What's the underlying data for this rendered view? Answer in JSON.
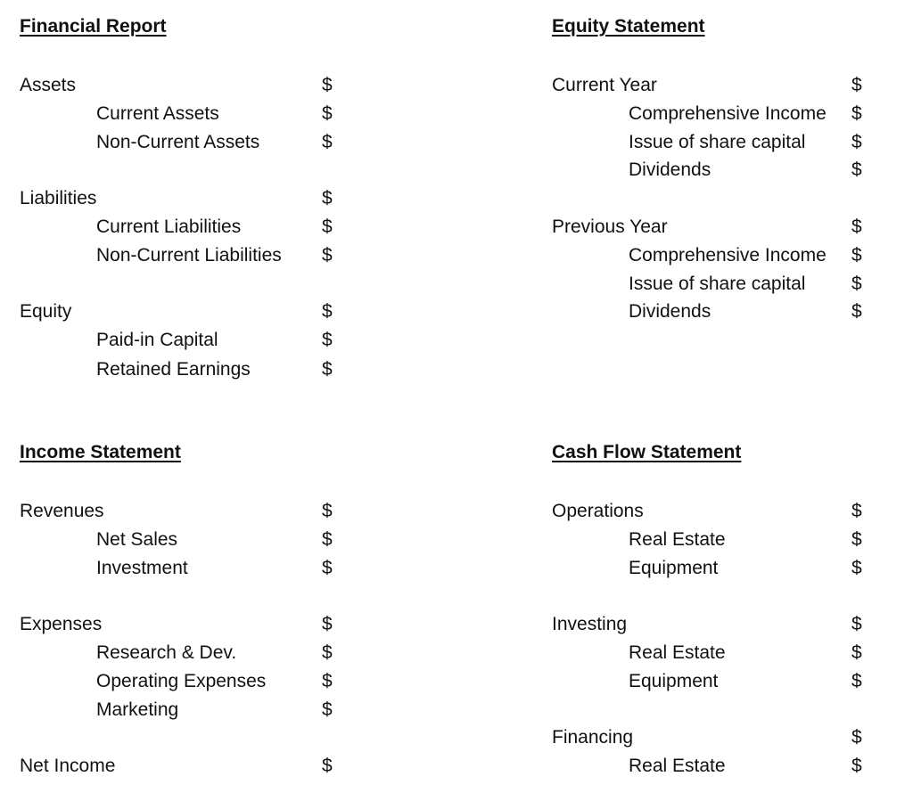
{
  "currency_symbol": "$",
  "financial_report": {
    "title": "Financial Report",
    "rows": [
      {
        "label": "Assets",
        "value": "$"
      },
      {
        "label": "Current Assets",
        "value": "$"
      },
      {
        "label": "Non-Current Assets",
        "value": "$"
      },
      {
        "label": "Liabilities",
        "value": "$"
      },
      {
        "label": "Current Liabilities",
        "value": "$"
      },
      {
        "label": "Non-Current Liabilities",
        "value": "$"
      },
      {
        "label": "Equity",
        "value": "$"
      },
      {
        "label": "Paid-in Capital",
        "value": "$"
      },
      {
        "label": "Retained Earnings",
        "value": "$"
      }
    ]
  },
  "equity_statement": {
    "title": "Equity Statement",
    "rows": [
      {
        "label": "Current Year",
        "value": "$"
      },
      {
        "label": "Comprehensive Income",
        "value": "$"
      },
      {
        "label": "Issue of share capital",
        "value": "$"
      },
      {
        "label": "Dividends",
        "value": "$"
      },
      {
        "label": "Previous Year",
        "value": "$"
      },
      {
        "label": "Comprehensive Income",
        "value": "$"
      },
      {
        "label": "Issue of share capital",
        "value": "$"
      },
      {
        "label": "Dividends",
        "value": "$"
      }
    ]
  },
  "income_statement": {
    "title": "Income Statement",
    "rows": [
      {
        "label": "Revenues",
        "value": "$"
      },
      {
        "label": "Net Sales",
        "value": "$"
      },
      {
        "label": "Investment",
        "value": "$"
      },
      {
        "label": "Expenses",
        "value": "$"
      },
      {
        "label": "Research & Dev.",
        "value": "$"
      },
      {
        "label": "Operating Expenses",
        "value": "$"
      },
      {
        "label": "Marketing",
        "value": "$"
      },
      {
        "label": "Net Income",
        "value": "$"
      }
    ]
  },
  "cash_flow_statement": {
    "title": "Cash Flow Statement",
    "rows": [
      {
        "label": "Operations",
        "value": "$"
      },
      {
        "label": "Real Estate",
        "value": "$"
      },
      {
        "label": "Equipment",
        "value": "$"
      },
      {
        "label": "Investing",
        "value": "$"
      },
      {
        "label": "Real Estate",
        "value": "$"
      },
      {
        "label": "Equipment",
        "value": "$"
      },
      {
        "label": "Financing",
        "value": "$"
      },
      {
        "label": "Real Estate",
        "value": "$"
      }
    ]
  }
}
